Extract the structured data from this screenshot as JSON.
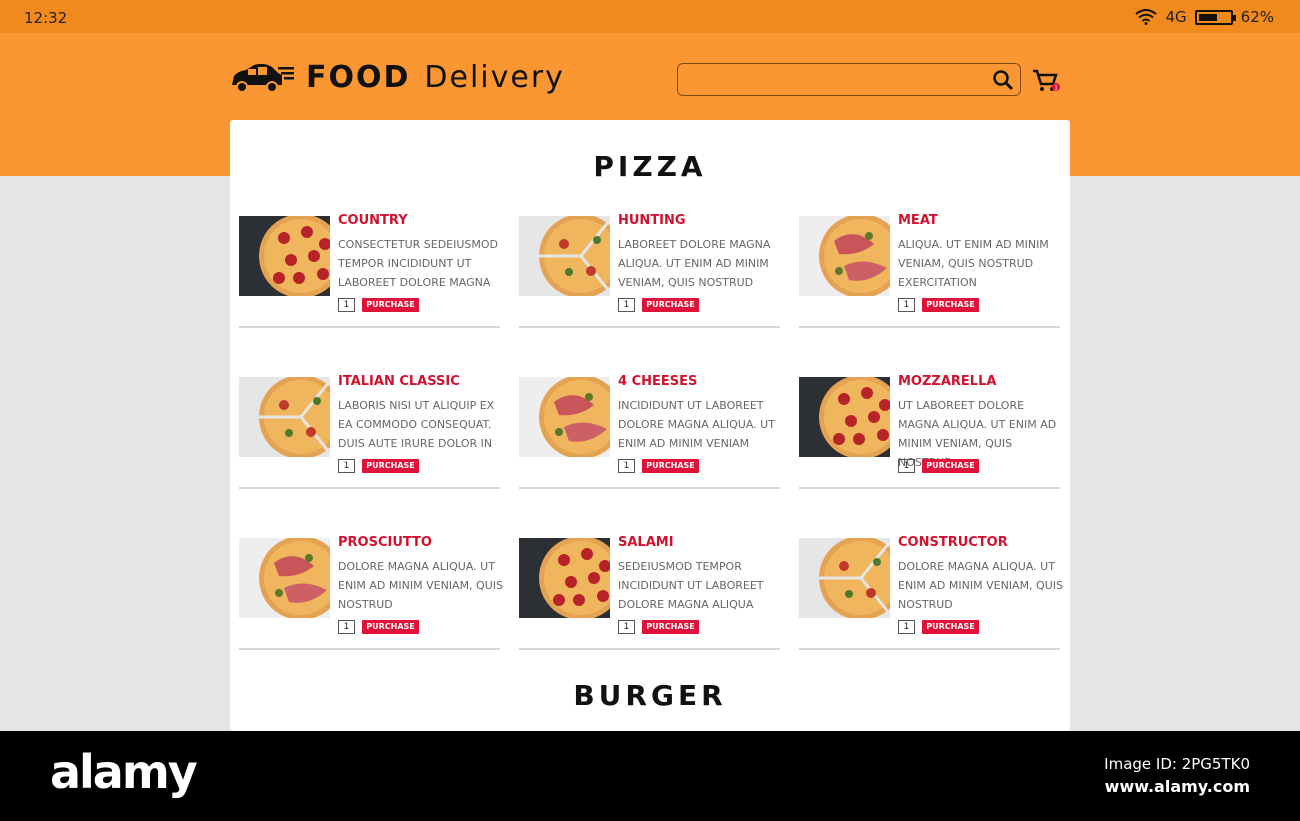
{
  "status": {
    "time": "12:32",
    "network": "4G",
    "battery": "62%",
    "battery_level": 0.62
  },
  "header": {
    "brand": "FOOD",
    "brand_sub": "Delivery",
    "search_placeholder": "",
    "cart_count": "1"
  },
  "sections": [
    {
      "title": "PIZZA"
    },
    {
      "title": "BURGER"
    }
  ],
  "items": [
    {
      "name": "COUNTRY",
      "desc": "CONSECTETUR SEDEIUSMOD TEMPOR INCIDIDUNT UT LABOREET DOLORE MAGNA",
      "qty": "1",
      "action": "PURCHASE",
      "img": "pepperoni"
    },
    {
      "name": "HUNTING",
      "desc": "LABOREET DOLORE MAGNA ALIQUA. UT ENIM AD MINIM VENIAM, QUIS NOSTRUD",
      "qty": "1",
      "action": "PURCHASE",
      "img": "slices"
    },
    {
      "name": "MEAT",
      "desc": "ALIQUA. UT ENIM AD MINIM VENIAM, QUIS NOSTRUD EXERCITATION",
      "qty": "1",
      "action": "PURCHASE",
      "img": "prosciutto"
    },
    {
      "name": "ITALIAN CLASSIC",
      "desc": "LABORIS NISI UT ALIQUIP EX EA COMMODO CONSEQUAT. DUIS AUTE IRURE DOLOR IN",
      "qty": "1",
      "action": "PURCHASE",
      "img": "slices"
    },
    {
      "name": "4 CHEESES",
      "desc": "INCIDIDUNT UT LABOREET DOLORE MAGNA ALIQUA. UT ENIM AD MINIM VENIAM",
      "qty": "1",
      "action": "PURCHASE",
      "img": "prosciutto"
    },
    {
      "name": "MOZZARELLA",
      "desc": "UT LABOREET DOLORE MAGNA ALIQUA. UT ENIM AD MINIM VENIAM, QUIS NOSTRUD",
      "qty": "1",
      "action": "PURCHASE",
      "img": "pepperoni"
    },
    {
      "name": "PROSCIUTTO",
      "desc": "DOLORE MAGNA ALIQUA. UT ENIM AD MINIM VENIAM, QUIS NOSTRUD",
      "qty": "1",
      "action": "PURCHASE",
      "img": "prosciutto"
    },
    {
      "name": "SALAMI",
      "desc": "SEDEIUSMOD TEMPOR INCIDIDUNT UT LABOREET DOLORE MAGNA ALIQUA",
      "qty": "1",
      "action": "PURCHASE",
      "img": "pepperoni"
    },
    {
      "name": "CONSTRUCTOR",
      "desc": "DOLORE MAGNA ALIQUA. UT ENIM AD MINIM VENIAM, QUIS NOSTRUD",
      "qty": "1",
      "action": "PURCHASE",
      "img": "slices"
    }
  ],
  "footer": {
    "logo": "alamy",
    "image_id": "Image ID: 2PG5TK0",
    "url": "www.alamy.com"
  },
  "colors": {
    "status_bar": "#f08a1c",
    "header": "#fb9733",
    "accent": "#d2112f",
    "button": "#e0123a",
    "page_bg": "#e5e5e5"
  }
}
